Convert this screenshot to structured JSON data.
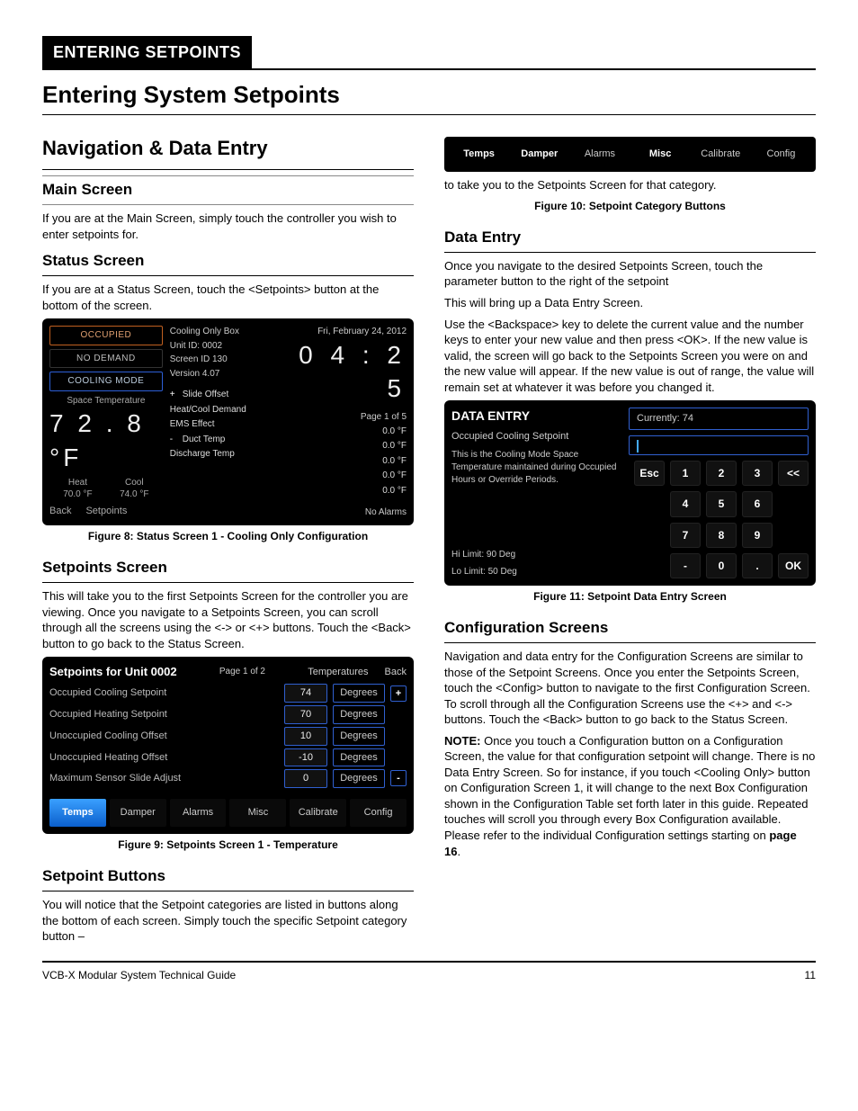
{
  "header": {
    "breadcrumb": "ENTERING SETPOINTS"
  },
  "title": "Entering System Setpoints",
  "left": {
    "h2": "Navigation & Data Entry",
    "ms_title": "Main Screen",
    "ms_text": "If you are at the Main Screen, simply touch the controller you wish to enter setpoints for.",
    "status_title": "Status Screen",
    "status_text": "If you are at a Status Screen, touch the <Setpoints> button at the bottom of the screen.",
    "fig8_caption": "Figure 8: Status Screen 1 - Cooling Only Configuration",
    "sps_title": "Setpoints Screen",
    "sps_text": "This will take you to the first Setpoints Screen for the controller you are viewing. Once you navigate to a Setpoints Screen, you can scroll through all the screens using the <-> or <+> buttons. Touch the <Back> button to go back to the Status Screen.",
    "fig9_caption": "Figure 9: Setpoints Screen 1 - Temperature",
    "setpoint_buttons_title": "Setpoint Buttons",
    "setpoint_button_items": [
      "You will notice that the Setpoint categories are listed in buttons along the bottom of each screen. Simply touch the specific Setpoint category button",
      "Damper",
      "Alarms",
      "Misc",
      "Calibrate",
      "Config",
      "to take you to the Setpoints Screen for that category."
    ]
  },
  "right": {
    "sp_buttons_text_pre": "You will notice that the Setpoint categories are listed in buttons along the bottom of each screen. Simply touch the specific Setpoint category button – ",
    "strip_tabs": [
      "Temps",
      "Damper",
      "Alarms",
      "Misc",
      "Calibrate",
      "Config"
    ],
    "sp_buttons_text_post": "to take you to the Setpoints Screen for that category.",
    "fig10_caption": "Figure 10: Setpoint Category Buttons",
    "de_title": "Data Entry",
    "de_p1": "Once you navigate to the desired Setpoints Screen, touch the parameter button to the right of the setpoint",
    "de_p2": "This will bring up a Data Entry Screen.",
    "de_p3": "Use the <Backspace> key to delete the current value and the number keys to enter your new value and then press <OK>. If the new value is valid, the screen will go back to the Setpoints Screen you were on and the new value will appear. If the new value is out of range, the value will remain set at whatever it was before you changed it.",
    "fig11_caption": "Figure 11: Setpoint Data Entry Screen",
    "config_title": "Configuration Screens",
    "config_p1": "Navigation and data entry for the Configuration Screens are similar to those of the Setpoint Screens. Once you enter the Setpoints Screen, touch the <Config> button to navigate to the first Configuration Screen. To scroll through all the Configuration Screens use the <+> and <-> buttons. Touch the <Back> button to go back to the Status Screen.",
    "config_note": "NOTE: Once you touch a Configuration button on a Configuration Screen, the value for that configuration setpoint will change. There is no Data Entry Screen. So for instance, if you touch <Cooling Only> button on Configuration Screen 1, it will change to the next Box Configuration shown in the Configuration Table set forth later in this guide. Repeated touches will scroll you through every Box Configuration available. Please refer to the individual Configuration settings starting on page 16."
  },
  "status_screen": {
    "badges": [
      "OCCUPIED",
      "NO DEMAND",
      "COOLING MODE"
    ],
    "space_label": "Space Temperature",
    "temp": "7 2 . 8 °F",
    "heat_label": "Heat",
    "heat_val": "70.0 °F",
    "cool_label": "Cool",
    "cool_val": "74.0 °F",
    "unit_type": "Cooling Only Box",
    "unit_id": "Unit ID: 0002",
    "screen_id": "Screen ID   130",
    "version": "Version  4.07",
    "date": "Fri, February 24, 2012",
    "clock": "0 4 : 2 5",
    "page": "Page 1 of 5",
    "rows": [
      {
        "l": "Slide Offset",
        "v": "0.0 °F"
      },
      {
        "l": "Heat/Cool Demand",
        "v": "0.0 °F"
      },
      {
        "l": "EMS Effect",
        "v": "0.0 °F"
      },
      {
        "l": "Duct Temp",
        "v": "0.0 °F"
      },
      {
        "l": "Discharge Temp",
        "v": "0.0 °F"
      }
    ],
    "back": "Back",
    "setpoints": "Setpoints",
    "noalarms": "No Alarms"
  },
  "setpoints_screen": {
    "title": "Setpoints for Unit 0002",
    "page": "Page 1 of 2",
    "group": "Temperatures",
    "back": "Back",
    "rows": [
      {
        "l": "Occupied Cooling Setpoint",
        "v": "74",
        "u": "Degrees"
      },
      {
        "l": "Occupied Heating Setpoint",
        "v": "70",
        "u": "Degrees"
      },
      {
        "l": "Unoccupied Cooling Offset",
        "v": "10",
        "u": "Degrees"
      },
      {
        "l": "Unoccupied Heating Offset",
        "v": "-10",
        "u": "Degrees"
      },
      {
        "l": "Maximum Sensor Slide Adjust",
        "v": "0",
        "u": "Degrees"
      }
    ],
    "tabs": [
      "Temps",
      "Damper",
      "Alarms",
      "Misc",
      "Calibrate",
      "Config"
    ]
  },
  "data_entry": {
    "title": "DATA ENTRY",
    "sp_name": "Occupied Cooling Setpoint",
    "desc": "This is the Cooling Mode Space Temperature maintained during Occupied Hours or Override Periods.",
    "currently": "Currently: 74",
    "hi": "Hi  Limit: 90 Deg",
    "lo": "Lo Limit: 50 Deg",
    "keys": [
      [
        "Esc",
        "1",
        "2",
        "3",
        "<<"
      ],
      [
        "",
        "4",
        "5",
        "6",
        ""
      ],
      [
        "",
        "7",
        "8",
        "9",
        ""
      ],
      [
        "",
        "-",
        "0",
        ".",
        "OK"
      ]
    ]
  },
  "footer": {
    "left": "VCB-X Modular System Technical Guide",
    "right": "11"
  }
}
